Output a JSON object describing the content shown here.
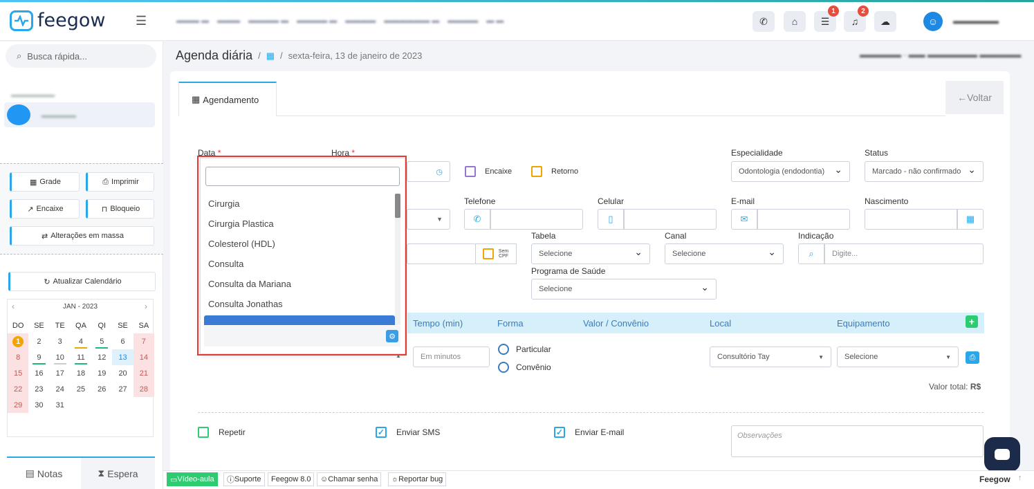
{
  "app": {
    "logo_text": "feegow",
    "accent": "#2aa7e8"
  },
  "header": {
    "badges": {
      "tasks": "1",
      "notifications": "2"
    }
  },
  "sidebar": {
    "search_placeholder": "Busca rápida...",
    "buttons": {
      "grade": "Grade",
      "imprimir": "Imprimir",
      "encaixe": "Encaixe",
      "bloqueio": "Bloqueio",
      "massa": "Alterações em massa",
      "atualizar": "Atualizar Calendário"
    },
    "calendar": {
      "month": "JAN - 2023",
      "weekdays": [
        "DO",
        "SE",
        "TE",
        "QA",
        "QI",
        "SE",
        "SA"
      ],
      "weeks": [
        [
          "1",
          "2",
          "3",
          "4",
          "5",
          "6",
          "7"
        ],
        [
          "8",
          "9",
          "10",
          "11",
          "12",
          "13",
          "14"
        ],
        [
          "15",
          "16",
          "17",
          "18",
          "19",
          "20",
          "21"
        ],
        [
          "22",
          "23",
          "24",
          "25",
          "26",
          "27",
          "28"
        ],
        [
          "29",
          "30",
          "31",
          "",
          "",
          "",
          ""
        ]
      ]
    },
    "bottom_tabs": {
      "notas": "Notas",
      "espera": "Espera"
    }
  },
  "breadcrumb": {
    "title": "Agenda diária",
    "date": "sexta-feira, 13 de janeiro de 2023"
  },
  "form": {
    "tab": "Agendamento",
    "voltar": "Voltar",
    "labels": {
      "data": "Data",
      "hora": "Hora",
      "encaixe": "Encaixe",
      "retorno": "Retorno",
      "especialidade": "Especialidade",
      "status": "Status",
      "telefone": "Telefone",
      "celular": "Celular",
      "email": "E-mail",
      "nascimento": "Nascimento",
      "tabela": "Tabela",
      "canal": "Canal",
      "indicacao": "Indicação",
      "programa": "Programa de Saúde",
      "sem_cpf": "Sem CPF",
      "required": "*"
    },
    "values": {
      "especialidade": "Odontologia (endodontia)",
      "status": "Marcado - não confirmado",
      "tabela": "Selecione",
      "canal": "Selecione",
      "programa": "Selecione",
      "indicacao_ph": "Digite..."
    },
    "procedures": {
      "headers": {
        "tempo": "Tempo (min)",
        "forma": "Forma",
        "valor": "Valor / Convênio",
        "local": "Local",
        "equip": "Equipamento"
      },
      "tempo_ph": "Em minutos",
      "particular": "Particular",
      "convenio": "Convênio",
      "local": "Consultório Tay",
      "equipamento": "Selecione",
      "valor_total": "Valor total:",
      "currency": "R$"
    },
    "options": {
      "repetir": "Repetir",
      "sms": "Enviar SMS",
      "email": "Enviar E-mail",
      "obs_ph": "Observações"
    }
  },
  "dropdown": {
    "items": [
      "Cirurgia",
      "Cirurgia Plastica",
      "Colesterol (HDL)",
      "Consulta",
      "Consulta da Mariana",
      "Consulta Jonathas"
    ]
  },
  "footer": {
    "video": "Vídeo-aula",
    "suporte": "Suporte",
    "versao": "Feegow 8.0",
    "senha": "Chamar senha",
    "bug": "Reportar bug",
    "brand": "Feegow"
  }
}
